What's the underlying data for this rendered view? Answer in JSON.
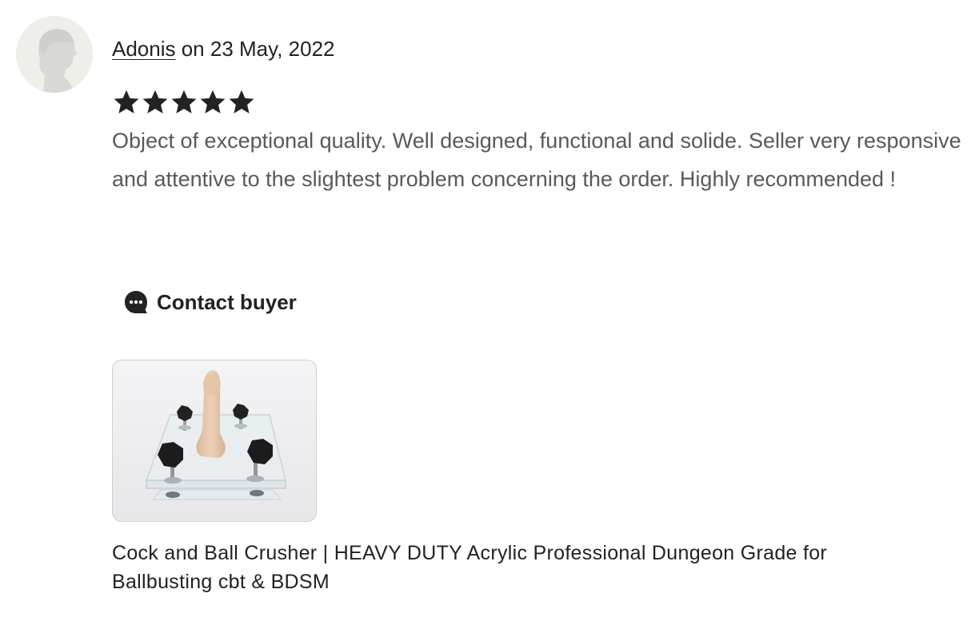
{
  "review": {
    "reviewer_name": "Adonis",
    "date_text": " on 23 May, 2022",
    "rating": 5,
    "rating_max": 5,
    "text": "Object of exceptional quality. Well designed, functional and solide. Seller very responsive and attentive to the slightest problem concerning the order. Highly recommended !",
    "avatar_icon": "person-silhouette-icon",
    "star_icon": "star-icon"
  },
  "contact": {
    "label": "Contact buyer",
    "icon": "chat-bubble-icon"
  },
  "listing": {
    "title": "Cock and Ball Crusher | HEAVY DUTY Acrylic Professional Dungeon Grade for Ballbusting cbt & BDSM"
  },
  "colors": {
    "text_primary": "#222222",
    "text_secondary": "#595959",
    "avatar_bg": "#efefea",
    "star": "#222222"
  }
}
